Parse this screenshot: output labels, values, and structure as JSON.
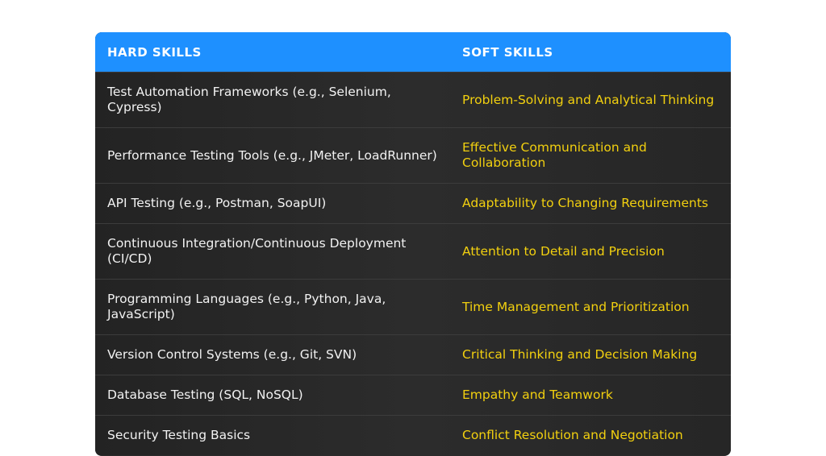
{
  "table": {
    "headers": {
      "hard": "HARD SKILLS",
      "soft": "SOFT SKILLS"
    },
    "rows": [
      {
        "hard": "Test Automation Frameworks (e.g., Selenium, Cypress)",
        "soft": "Problem-Solving and Analytical Thinking"
      },
      {
        "hard": "Performance Testing Tools (e.g., JMeter, LoadRunner)",
        "soft": "Effective Communication and Collaboration"
      },
      {
        "hard": "API Testing (e.g., Postman, SoapUI)",
        "soft": "Adaptability to Changing Requirements"
      },
      {
        "hard": "Continuous Integration/Continuous Deployment (CI/CD)",
        "soft": "Attention to Detail and Precision"
      },
      {
        "hard": "Programming Languages (e.g., Python, Java, JavaScript)",
        "soft": "Time Management and Prioritization"
      },
      {
        "hard": "Version Control Systems (e.g., Git, SVN)",
        "soft": "Critical Thinking and Decision Making"
      },
      {
        "hard": "Database Testing (SQL, NoSQL)",
        "soft": "Empathy and Teamwork"
      },
      {
        "hard": "Security Testing Basics",
        "soft": "Conflict Resolution and Negotiation"
      }
    ],
    "colors": {
      "header_bg": "#1e90ff",
      "header_text": "#ffffff",
      "row_bg": "#2b2b2b",
      "hard_text": "#f2f2f2",
      "soft_text": "#f2d00f"
    }
  }
}
